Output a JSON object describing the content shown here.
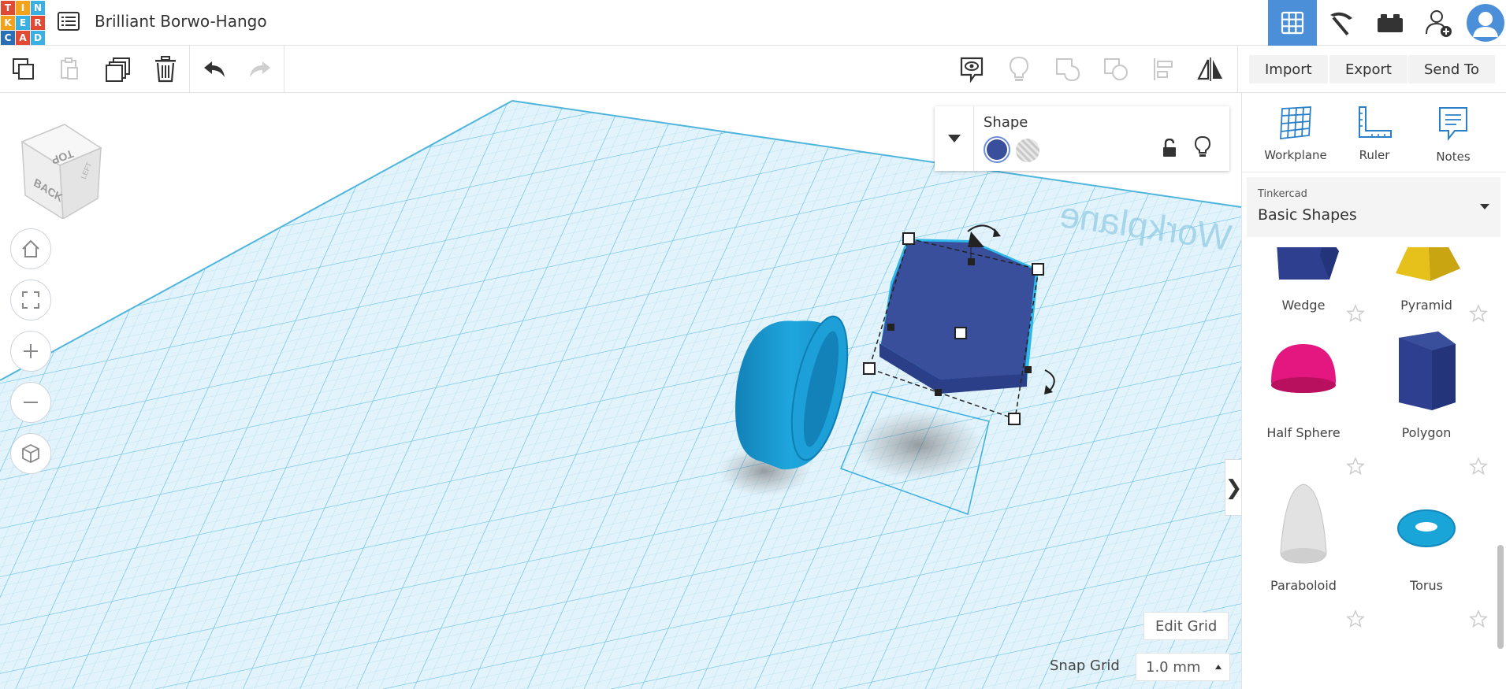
{
  "app": {
    "logo_letters": [
      "T",
      "I",
      "N",
      "K",
      "E",
      "R",
      "C",
      "A",
      "D"
    ],
    "doc_title": "Brilliant Borwo-Hango",
    "header_buttons": [
      {
        "name": "3d-design-view",
        "icon": "grid-icon",
        "active": true
      },
      {
        "name": "codeblocks-view",
        "icon": "pickaxe-icon",
        "active": false
      },
      {
        "name": "bricks-view",
        "icon": "brick-icon",
        "active": false
      },
      {
        "name": "invite-user",
        "icon": "add-user-icon",
        "active": false
      }
    ]
  },
  "toolbar": {
    "edit_tools": [
      "copy-icon",
      "paste-icon",
      "duplicate-icon",
      "delete-icon",
      "undo-icon",
      "redo-icon"
    ],
    "view_tools": [
      "notes-view-icon",
      "show-lightbulb-icon",
      "group-icon",
      "ungroup-icon",
      "align-icon",
      "mirror-icon"
    ],
    "import_label": "Import",
    "export_label": "Export",
    "send_to_label": "Send To"
  },
  "viewcube": {
    "top": "TOP",
    "back": "BACK",
    "left": "LEFT"
  },
  "workplane_label": "Workplane",
  "shape_panel": {
    "title": "Shape",
    "solid_color": "#3a4f9c",
    "hole_option": "hole-swatch"
  },
  "grid": {
    "edit_grid_label": "Edit Grid",
    "snap_grid_label": "Snap Grid",
    "snap_grid_value": "1.0 mm"
  },
  "right_panel": {
    "tools": [
      {
        "label": "Workplane",
        "icon": "workplane-icon"
      },
      {
        "label": "Ruler",
        "icon": "ruler-icon"
      },
      {
        "label": "Notes",
        "icon": "notes-icon"
      }
    ],
    "library_source": "Tinkercad",
    "library_name": "Basic Shapes",
    "shapes": [
      {
        "name": "Wedge",
        "color": "#2e3f8f"
      },
      {
        "name": "Pyramid",
        "color": "#e6c01b"
      },
      {
        "name": "Half Sphere",
        "color": "#e3177f"
      },
      {
        "name": "Polygon",
        "color": "#2e3f8f"
      },
      {
        "name": "Paraboloid",
        "color": "#d9d9d9"
      },
      {
        "name": "Torus",
        "color": "#1aa5d8"
      }
    ]
  },
  "colors": {
    "accent": "#4c8fd9",
    "grid_fill": "#dff1fa",
    "grid_line": "#8fd0ec",
    "tube": "#1a9fd6",
    "selected_shape": "#3a4f9c"
  }
}
